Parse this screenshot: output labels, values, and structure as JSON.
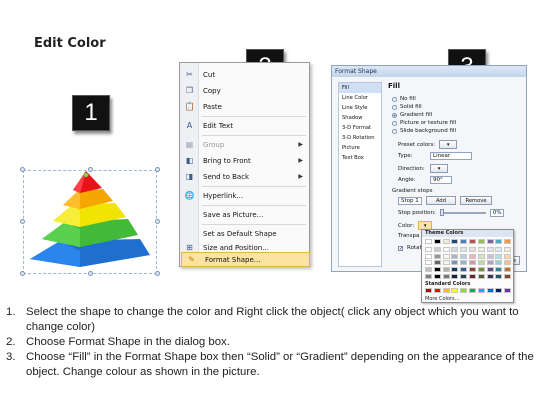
{
  "title": "Edit Color",
  "steps_badges": [
    "1",
    "2",
    "3"
  ],
  "context_menu": {
    "items": [
      {
        "label": "Cut",
        "icon": "scissors-icon",
        "disabled": false,
        "submenu": false
      },
      {
        "label": "Copy",
        "icon": "copy-icon",
        "disabled": false,
        "submenu": false
      },
      {
        "label": "Paste",
        "icon": "paste-icon",
        "disabled": false,
        "submenu": false
      },
      {
        "label": "Edit Text",
        "icon": "edit-text-icon",
        "disabled": false,
        "submenu": false
      },
      {
        "label": "Group",
        "icon": "group-icon",
        "disabled": true,
        "submenu": true
      },
      {
        "label": "Bring to Front",
        "icon": "bring-front-icon",
        "disabled": false,
        "submenu": true
      },
      {
        "label": "Send to Back",
        "icon": "send-back-icon",
        "disabled": false,
        "submenu": true
      },
      {
        "label": "Hyperlink...",
        "icon": "hyperlink-icon",
        "disabled": false,
        "submenu": false
      },
      {
        "label": "Save as Picture...",
        "icon": "",
        "disabled": false,
        "submenu": false
      },
      {
        "label": "Set as Default Shape",
        "icon": "",
        "disabled": false,
        "submenu": false
      },
      {
        "label": "Size and Position...",
        "icon": "size-icon",
        "disabled": false,
        "submenu": false
      },
      {
        "label": "Format Shape...",
        "icon": "format-shape-icon",
        "disabled": false,
        "submenu": false,
        "highlighted": true
      }
    ]
  },
  "dialog": {
    "title": "Format Shape",
    "nav": [
      "Fill",
      "Line Color",
      "Line Style",
      "Shadow",
      "3-D Format",
      "3-D Rotation",
      "Picture",
      "Text Box"
    ],
    "selected_nav": "Fill",
    "heading": "Fill",
    "fill_options": [
      "No fill",
      "Solid fill",
      "Gradient fill",
      "Picture or texture fill",
      "Slide background fill"
    ],
    "selected_fill": "Gradient fill",
    "preset_colors_label": "Preset colors:",
    "type_label": "Type:",
    "type_value": "Linear",
    "direction_label": "Direction:",
    "angle_label": "Angle:",
    "angle_value": "90°",
    "gradient_stops_label": "Gradient stops",
    "stop_value": "Stop 1",
    "add_label": "Add",
    "remove_label": "Remove",
    "stop_position_label": "Stop position:",
    "stop_position_value": "0%",
    "color_label": "Color:",
    "transparency_label": "Transpa",
    "rotate_label": "Rotate",
    "close_fragment": "se"
  },
  "palette": {
    "theme_label": "Theme Colors",
    "standard_label": "Standard Colors",
    "more_label": "More Colors...",
    "theme_top": [
      "#ffffff",
      "#000000",
      "#eeece1",
      "#1f497d",
      "#4f81bd",
      "#c0504d",
      "#9bbb59",
      "#8064a2",
      "#4bacc6",
      "#f79646"
    ],
    "standard": [
      "#c00000",
      "#ff0000",
      "#ffc000",
      "#ffff00",
      "#92d050",
      "#00b050",
      "#00b0f0",
      "#0070c0",
      "#002060",
      "#7030a0"
    ]
  },
  "pyramid_colors": [
    "#e8121b",
    "#f5a600",
    "#f0e400",
    "#43b93a",
    "#1e6fcf"
  ],
  "instructions": [
    {
      "num": "1.",
      "text": "Select the shape to change the color and Right click the object( click any object which you want to change color)"
    },
    {
      "num": "2.",
      "text": "Choose Format Shape in the dialog box."
    },
    {
      "num": "3.",
      "text": "Choose “Fill” in the Format Shape box then “Solid” or “Gradient” depending on the appearance of the object. Change colour as shown in the picture."
    }
  ]
}
